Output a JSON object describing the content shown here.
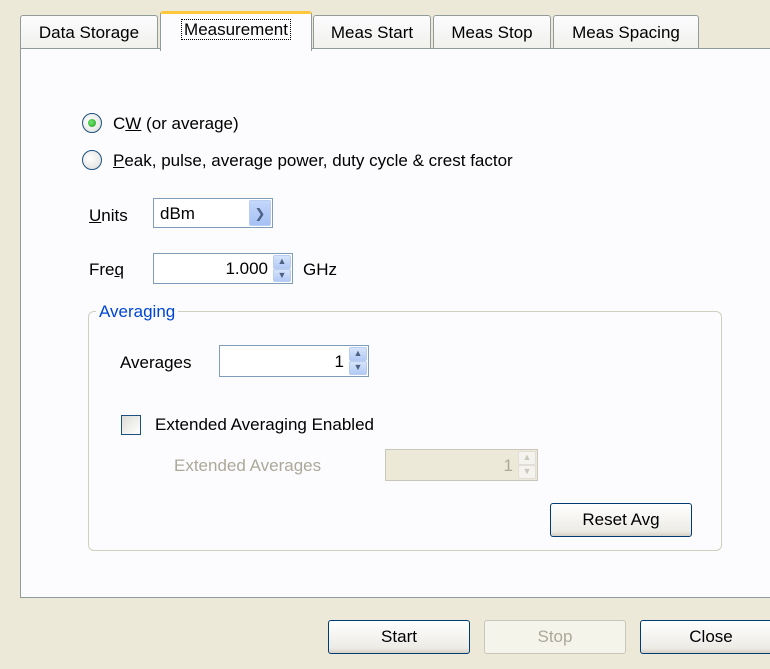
{
  "tabs": [
    {
      "label": "Data Storage"
    },
    {
      "label": "Measurement"
    },
    {
      "label": "Meas Start"
    },
    {
      "label": "Meas Stop"
    },
    {
      "label": "Meas Spacing"
    }
  ],
  "mode": {
    "cw_prefix": "C",
    "cw_hotkey": "W",
    "cw_suffix": " (or average)",
    "peak_hotkey": "P",
    "peak_suffix": "eak, pulse, average power, duty cycle & crest factor",
    "selected": "cw"
  },
  "units": {
    "hotkey": "U",
    "label_rest": "nits",
    "value": "dBm"
  },
  "freq": {
    "label_prefix": "Fre",
    "hotkey": "q",
    "value": "1.000",
    "unit": "GHz"
  },
  "averaging": {
    "legend": "Averaging",
    "averages_label": "Averages",
    "averages_value": "1",
    "extended_label": "Extended Averaging Enabled",
    "extended_checked": false,
    "extended_averages_label": "Extended Averages",
    "extended_averages_value": "1",
    "reset_label": "Reset Avg"
  },
  "buttons": {
    "start": "Start",
    "stop": "Stop",
    "close": "Close"
  }
}
